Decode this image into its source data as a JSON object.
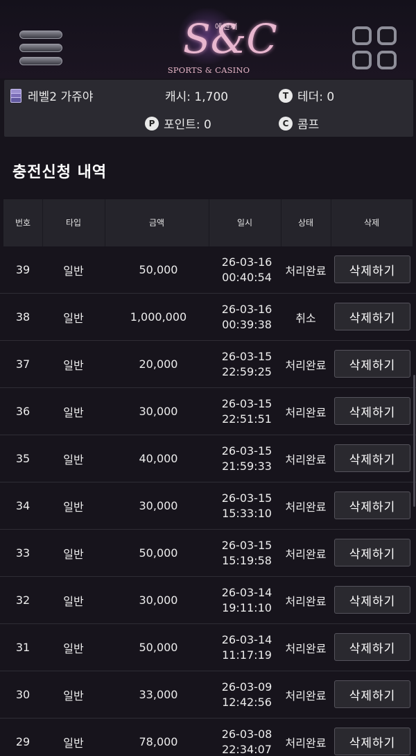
{
  "header": {
    "logo_mark": "S&C",
    "logo_korean": "에쎈씨",
    "logo_subtitle": "SPORTS & CASINO",
    "menu_icon": "hamburger-menu-icon",
    "grid_icon": "grid-menu-icon"
  },
  "status": {
    "level": "레벨2 가쥬야",
    "cash": "캐시: 1,700",
    "tether": "테더: 0",
    "points": "포인트: 0",
    "comp": "콤프",
    "tether_badge": "T",
    "points_badge": "P",
    "comp_badge": "C"
  },
  "page_title": "충전신청 내역",
  "table": {
    "headers": [
      "번호",
      "타입",
      "금액",
      "일시",
      "상태",
      "삭제"
    ],
    "delete_label": "삭제하기",
    "rows": [
      {
        "no": "39",
        "type": "일반",
        "amount": "50,000",
        "date": "26-03-16",
        "time": "00:40:54",
        "status": "처리완료"
      },
      {
        "no": "38",
        "type": "일반",
        "amount": "1,000,000",
        "date": "26-03-16",
        "time": "00:39:38",
        "status": "취소"
      },
      {
        "no": "37",
        "type": "일반",
        "amount": "20,000",
        "date": "26-03-15",
        "time": "22:59:25",
        "status": "처리완료"
      },
      {
        "no": "36",
        "type": "일반",
        "amount": "30,000",
        "date": "26-03-15",
        "time": "22:51:51",
        "status": "처리완료"
      },
      {
        "no": "35",
        "type": "일반",
        "amount": "40,000",
        "date": "26-03-15",
        "time": "21:59:33",
        "status": "처리완료"
      },
      {
        "no": "34",
        "type": "일반",
        "amount": "30,000",
        "date": "26-03-15",
        "time": "15:33:10",
        "status": "처리완료"
      },
      {
        "no": "33",
        "type": "일반",
        "amount": "50,000",
        "date": "26-03-15",
        "time": "15:19:58",
        "status": "처리완료"
      },
      {
        "no": "32",
        "type": "일반",
        "amount": "30,000",
        "date": "26-03-14",
        "time": "19:11:10",
        "status": "처리완료"
      },
      {
        "no": "31",
        "type": "일반",
        "amount": "50,000",
        "date": "26-03-14",
        "time": "11:17:19",
        "status": "처리완료"
      },
      {
        "no": "30",
        "type": "일반",
        "amount": "33,000",
        "date": "26-03-09",
        "time": "12:42:56",
        "status": "처리완료"
      },
      {
        "no": "29",
        "type": "일반",
        "amount": "78,000",
        "date": "26-03-08",
        "time": "22:34:07",
        "status": "처리완료"
      }
    ]
  }
}
